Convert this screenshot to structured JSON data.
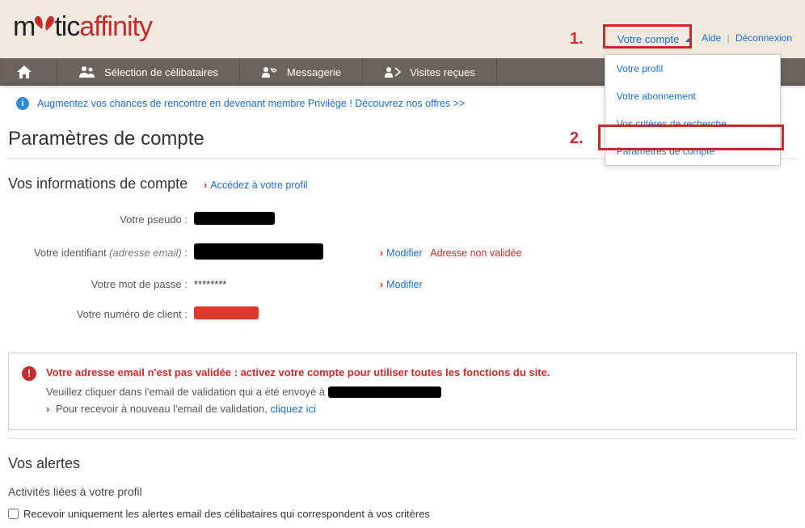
{
  "logo": {
    "part1": "m",
    "part2": "tic",
    "part3": "affinity"
  },
  "top": {
    "account_label": "Votre compte",
    "help": "Aide",
    "logout": "Déconnexion"
  },
  "account_menu": {
    "items": [
      "Votre profil",
      "Votre abonnement",
      "Vos critères de recherche",
      "Paramètres de compte"
    ]
  },
  "nav": {
    "selection": "Sélection de célibataires",
    "messaging": "Messagerie",
    "visits": "Visites reçues"
  },
  "promo": "Augmentez vos chances de rencontre en devenant membre Privilège ! Découvrez nos offres >>",
  "page_title": "Paramètres de compte",
  "account_info": {
    "title": "Vos informations de compte",
    "profile_link": "Accédez à votre profil",
    "rows": {
      "pseudo_label": "Votre pseudo :",
      "email_label_main": "Votre identifiant ",
      "email_label_note": "(adresse email)",
      "email_label_colon": " :",
      "password_label": "Votre mot de passe :",
      "password_value": "********",
      "client_label": "Votre numéro de client :",
      "modify": "Modifier",
      "unvalidated": "Adresse non validée"
    }
  },
  "alert": {
    "title": "Votre adresse email n'est pas validée : activez votre compte pour utiliser toutes les fonctions du site.",
    "line1": "Veuillez cliquer dans l'email de validation qui a été envoyé à",
    "line2_prefix": "Pour recevoir à nouveau l'email de validation, ",
    "line2_link": "cliquez ici"
  },
  "alerts_section": {
    "title": "Vos alertes",
    "sub": "Activités liées à votre profil",
    "checkbox_label": "Recevoir uniquement les alertes email des célibataires qui correspondent à vos critères"
  },
  "annot": {
    "one": "1.",
    "two": "2."
  }
}
